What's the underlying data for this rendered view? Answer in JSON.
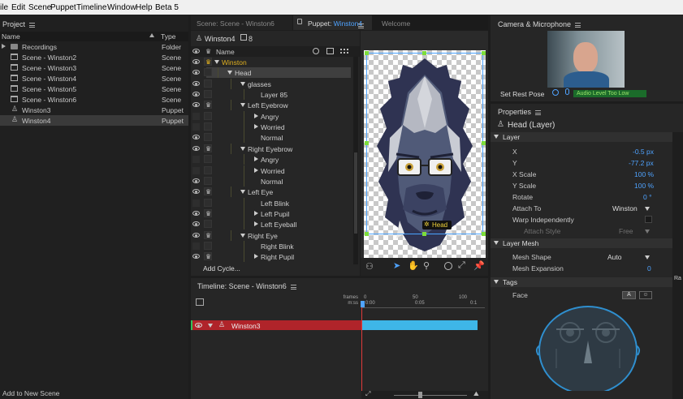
{
  "menu": [
    "ile",
    "Edit",
    "Scene",
    "Puppet",
    "Timeline",
    "Window",
    "Help",
    "Beta 5"
  ],
  "project": {
    "title": "Project",
    "col_name": "Name",
    "col_type": "Type",
    "items": [
      {
        "name": "Recordings",
        "type": "Folder",
        "kind": "folder"
      },
      {
        "name": "Scene - Winston2",
        "type": "Scene",
        "kind": "scene"
      },
      {
        "name": "Scene - Winston3",
        "type": "Scene",
        "kind": "scene"
      },
      {
        "name": "Scene - Winston4",
        "type": "Scene",
        "kind": "scene"
      },
      {
        "name": "Scene - Winston5",
        "type": "Scene",
        "kind": "scene"
      },
      {
        "name": "Scene - Winston6",
        "type": "Scene",
        "kind": "scene"
      },
      {
        "name": "Winston3",
        "type": "Puppet",
        "kind": "puppet"
      },
      {
        "name": "Winston4",
        "type": "Puppet",
        "kind": "puppet"
      }
    ],
    "footer": "Add to New Scene"
  },
  "tabs": {
    "scene": "Scene: Scene - Winston6",
    "puppet_prefix": "Puppet: ",
    "puppet_name": "Winston4",
    "welcome": "Welcome"
  },
  "puppet": {
    "name": "Winston4",
    "count": "8",
    "col_name": "Name",
    "add_cycle": "Add Cycle...",
    "tree": [
      {
        "label": "Winston",
        "eye": true,
        "crown": true,
        "arrow": "down",
        "highlight": "gold"
      },
      {
        "label": "Head",
        "eye": true,
        "crown": false,
        "arrow": "down",
        "highlight": "selected"
      },
      {
        "label": "glasses",
        "eye": true,
        "crown": false,
        "arrow": "down"
      },
      {
        "label": "Layer 85",
        "eye": true,
        "crown": false,
        "arrow": ""
      },
      {
        "label": "Left Eyebrow",
        "eye": true,
        "crown": true,
        "arrow": "down"
      },
      {
        "label": "Angry",
        "eye": false,
        "crown": false,
        "arrow": "right"
      },
      {
        "label": "Worried",
        "eye": false,
        "crown": false,
        "arrow": "right"
      },
      {
        "label": "Normal",
        "eye": true,
        "crown": false,
        "arrow": ""
      },
      {
        "label": "Right Eyebrow",
        "eye": true,
        "crown": true,
        "arrow": "down"
      },
      {
        "label": "Angry",
        "eye": false,
        "crown": false,
        "arrow": "right"
      },
      {
        "label": "Worried",
        "eye": false,
        "crown": false,
        "arrow": "right"
      },
      {
        "label": "Normal",
        "eye": true,
        "crown": false,
        "arrow": ""
      },
      {
        "label": "Left Eye",
        "eye": true,
        "crown": true,
        "arrow": "down"
      },
      {
        "label": "Left Blink",
        "eye": false,
        "crown": false,
        "arrow": ""
      },
      {
        "label": "Left Pupil",
        "eye": true,
        "crown": true,
        "arrow": "right"
      },
      {
        "label": "Left Eyeball",
        "eye": true,
        "crown": false,
        "arrow": "right"
      },
      {
        "label": "Right Eye",
        "eye": true,
        "crown": true,
        "arrow": "down"
      },
      {
        "label": "Right Blink",
        "eye": false,
        "crown": false,
        "arrow": ""
      },
      {
        "label": "Right Pupil",
        "eye": true,
        "crown": true,
        "arrow": "right"
      }
    ]
  },
  "canvas": {
    "handle_label": "Head"
  },
  "camera": {
    "title": "Camera & Microphone",
    "set_rest_pose": "Set Rest Pose",
    "audio_status": "Audio Level Too Low"
  },
  "properties": {
    "title": "Properties",
    "selected": "Head (Layer)",
    "layer_section": "Layer",
    "x_label": "X",
    "x_value": "-0.5 px",
    "y_label": "Y",
    "y_value": "-77.2 px",
    "xscale_label": "X Scale",
    "xscale_value": "100 %",
    "yscale_label": "Y Scale",
    "yscale_value": "100 %",
    "rotate_label": "Rotate",
    "rotate_value": "0 °",
    "attach_label": "Attach To",
    "attach_value": "Winston",
    "warp_label": "Warp Independently",
    "attach_style_label": "Attach Style",
    "attach_style_value": "Free",
    "mesh_section": "Layer Mesh",
    "mesh_shape_label": "Mesh Shape",
    "mesh_shape_value": "Auto",
    "mesh_exp_label": "Mesh Expansion",
    "mesh_exp_value": "0",
    "tags_section": "Tags",
    "face_label": "Face",
    "tag_btn_a": "A",
    "side_tab": "Ra"
  },
  "timeline": {
    "title": "Timeline: Scene - Winston6",
    "frames_label": "frames",
    "mss_label": "m:ss",
    "ruler_frames": [
      "0",
      "50",
      "100"
    ],
    "ruler_times": [
      "0:00",
      "0:05",
      "0:1"
    ],
    "track_name": "Winston3"
  },
  "colors": {
    "accent": "#4fa3ff",
    "track_red": "#b0242a",
    "track_blue": "#3eb6e8",
    "playhead": "#e03a3a"
  }
}
